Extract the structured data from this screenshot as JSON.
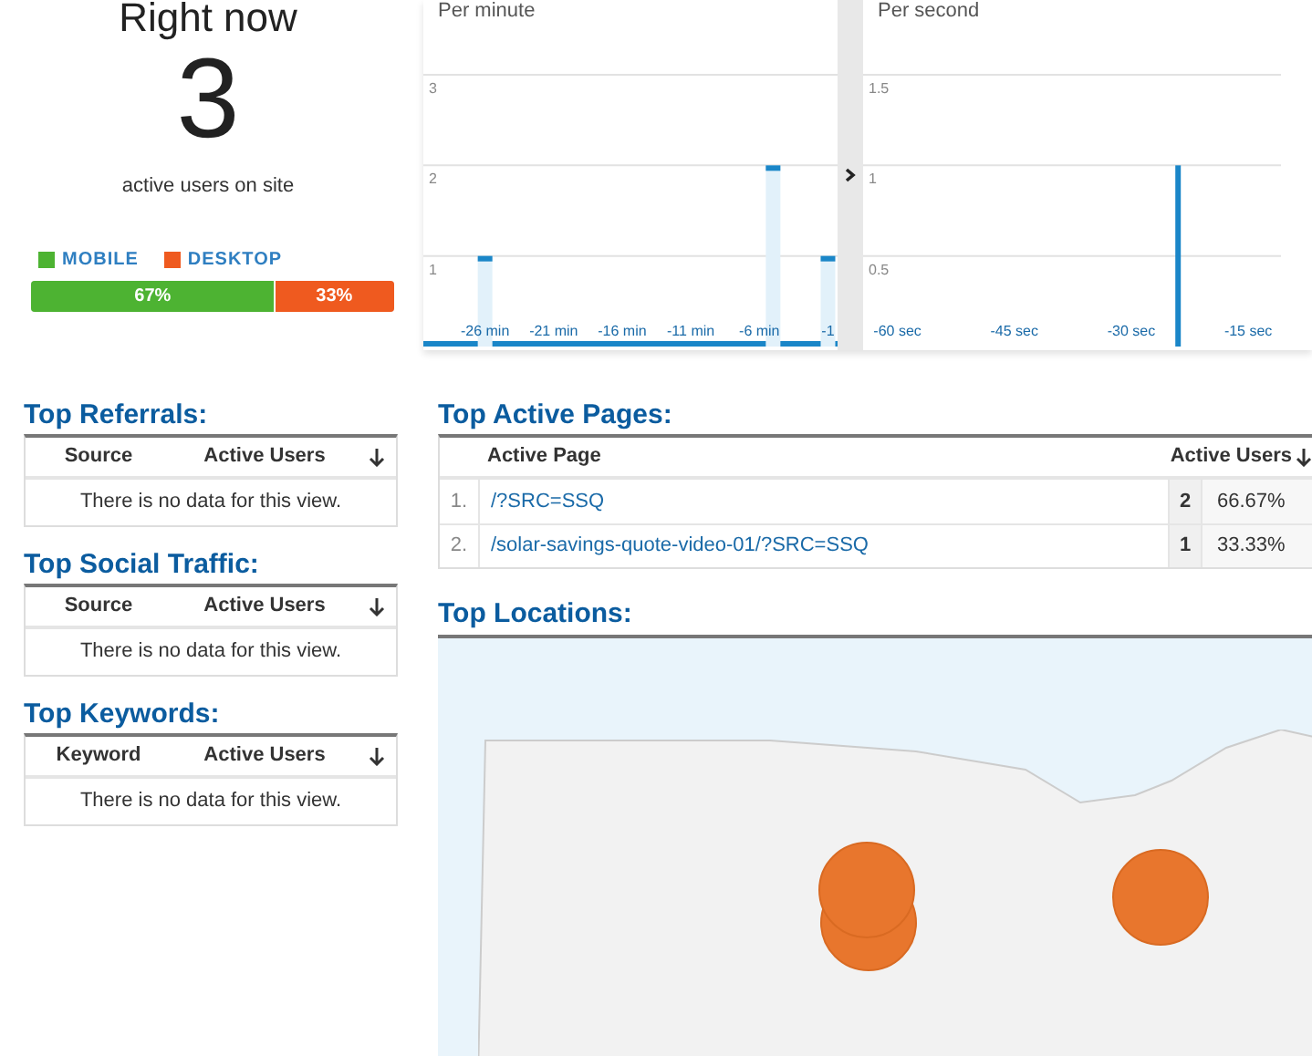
{
  "summary": {
    "title": "Right now",
    "count": "3",
    "caption": "active users on site"
  },
  "devices": [
    {
      "label": "MOBILE",
      "color": "#4db332",
      "level": 0.67,
      "percent": "67%"
    },
    {
      "label": "DESKTOP",
      "color": "#ef5a1f",
      "level": 0.33,
      "percent": "33%"
    }
  ],
  "charts": [
    {
      "title": "Per minute",
      "chart_data": {
        "type": "bar",
        "x": [
          -26,
          -5,
          -1
        ],
        "values": [
          1,
          2,
          1
        ],
        "grid": true,
        "xlim": [
          -30.5,
          -0.3
        ],
        "ylim": [
          0,
          3
        ],
        "yticks": [
          1,
          2,
          3
        ],
        "xticks": [
          {
            "value": -26,
            "label": "-26 min"
          },
          {
            "value": -21,
            "label": "-21 min"
          },
          {
            "value": -16,
            "label": "-16 min"
          },
          {
            "value": -11,
            "label": "-11 min"
          },
          {
            "value": -6,
            "label": "-6 min"
          },
          {
            "value": -1,
            "label": "-1"
          }
        ]
      }
    },
    {
      "title": "Per second",
      "chart_data": {
        "type": "bar",
        "x": [
          -24
        ],
        "values": [
          1
        ],
        "grid": true,
        "xlim": [
          -64.4,
          -10.8
        ],
        "ylim": [
          0,
          1.5
        ],
        "yticks": [
          {
            "value": 0.5,
            "label": "0.5"
          },
          1,
          1.5
        ],
        "xticks": [
          {
            "value": -60,
            "label": "-60 sec"
          },
          {
            "value": -45,
            "label": "-45 sec"
          },
          {
            "value": -30,
            "label": "-30 sec"
          },
          {
            "value": -15,
            "label": "-15 sec"
          }
        ]
      }
    }
  ],
  "side_tables": [
    {
      "title": "Top Referrals:",
      "columns": [
        "Source",
        "Active Users"
      ],
      "empty_message": "There is no data for this view."
    },
    {
      "title": "Top Social Traffic:",
      "columns": [
        "Source",
        "Active Users"
      ],
      "empty_message": "There is no data for this view."
    },
    {
      "title": "Top Keywords:",
      "columns": [
        "Keyword",
        "Active Users"
      ],
      "empty_message": "There is no data for this view."
    }
  ],
  "top_pages": {
    "title": "Top Active Pages:",
    "columns": [
      "Active Page",
      "Active Users"
    ],
    "rows": [
      {
        "index": "1.",
        "page": "/?SRC=SSQ",
        "users": "2",
        "percent": "66.67%"
      },
      {
        "index": "2.",
        "page": "/solar-savings-quote-video-01/?SRC=SSQ",
        "users": "1",
        "percent": "33.33%"
      }
    ]
  },
  "locations": {
    "title": "Top Locations:"
  }
}
